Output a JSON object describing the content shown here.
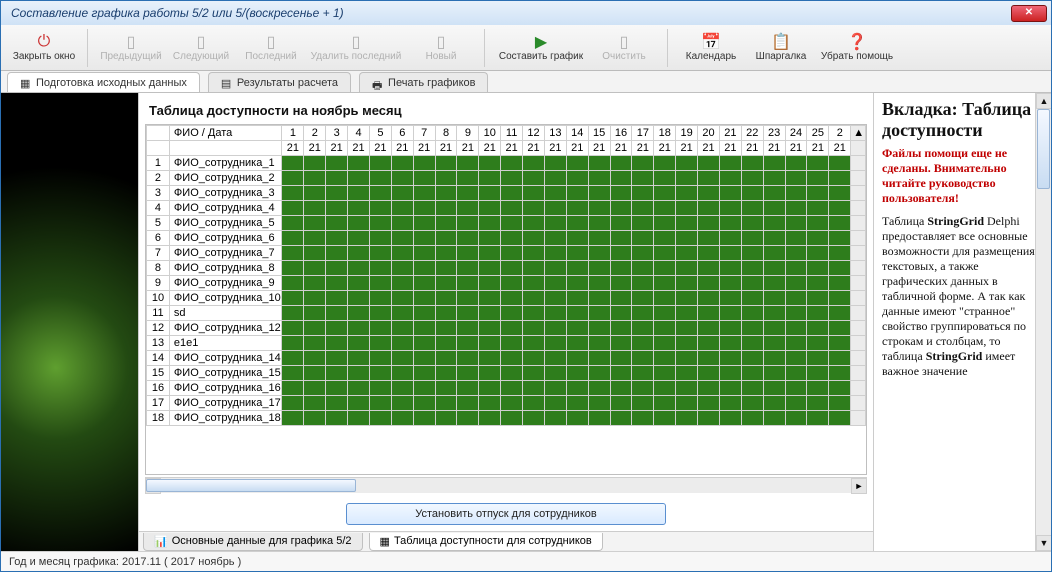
{
  "window": {
    "title": "Составление графика работы 5/2 или 5/(воскресенье + 1)"
  },
  "toolbar": {
    "close": "Закрыть окно",
    "prev": "Предыдущий",
    "next": "Следующий",
    "last": "Последний",
    "delete_last": "Удалить последний",
    "new": "Новый",
    "compose": "Составить график",
    "clear": "Очистить",
    "calendar": "Календарь",
    "cheat": "Шпаргалка",
    "hidehelp": "Убрать помощь"
  },
  "tabs": {
    "t1": "Подготовка исходных данных",
    "t2": "Результаты расчета",
    "t3": "Печать графиков"
  },
  "panel": {
    "title": "Таблица доступности на ноябрь месяц"
  },
  "grid": {
    "corner": "ФИО / Дата",
    "days": [
      "1",
      "2",
      "3",
      "4",
      "5",
      "6",
      "7",
      "8",
      "9",
      "10",
      "11",
      "12",
      "13",
      "14",
      "15",
      "16",
      "17",
      "18",
      "19",
      "20",
      "21",
      "22",
      "23",
      "24",
      "25",
      "2"
    ],
    "row2": "21",
    "rows": [
      {
        "n": "1",
        "name": "ФИО_сотрудника_1"
      },
      {
        "n": "2",
        "name": "ФИО_сотрудника_2"
      },
      {
        "n": "3",
        "name": "ФИО_сотрудника_3"
      },
      {
        "n": "4",
        "name": "ФИО_сотрудника_4"
      },
      {
        "n": "5",
        "name": "ФИО_сотрудника_5"
      },
      {
        "n": "6",
        "name": "ФИО_сотрудника_6"
      },
      {
        "n": "7",
        "name": "ФИО_сотрудника_7"
      },
      {
        "n": "8",
        "name": "ФИО_сотрудника_8"
      },
      {
        "n": "9",
        "name": "ФИО_сотрудника_9"
      },
      {
        "n": "10",
        "name": "ФИО_сотрудника_10"
      },
      {
        "n": "11",
        "name": "sd"
      },
      {
        "n": "12",
        "name": "ФИО_сотрудника_12"
      },
      {
        "n": "13",
        "name": "e1e1"
      },
      {
        "n": "14",
        "name": "ФИО_сотрудника_14"
      },
      {
        "n": "15",
        "name": "ФИО_сотрудника_15"
      },
      {
        "n": "16",
        "name": "ФИО_сотрудника_16"
      },
      {
        "n": "17",
        "name": "ФИО_сотрудника_17"
      },
      {
        "n": "18",
        "name": "ФИО_сотрудника_18"
      }
    ]
  },
  "vacation_btn": "Установить отпуск для сотрудников",
  "help": {
    "heading": "Вкладка: Таблица доступности",
    "warn": "Файлы помощи еще не сделаны. Внимательно читайте руководство пользователя!",
    "body1": "Таблица ",
    "body1b": "StringGrid",
    "body2": " Delphi предоставляет все основные возможности для размещения текстовых, а также графических данных в табличной форме. А так как данные имеют \"странное\" свойство группироваться по строкам и столбцам, то таблица ",
    "body2b": "StringGrid",
    "body3": " имеет важное значение"
  },
  "bottom_tabs": {
    "b1": "Основные данные для графика 5/2",
    "b2": "Таблица доступности для сотрудников"
  },
  "status": "Год и месяц графика:  2017.11  ( 2017  ноябрь )"
}
